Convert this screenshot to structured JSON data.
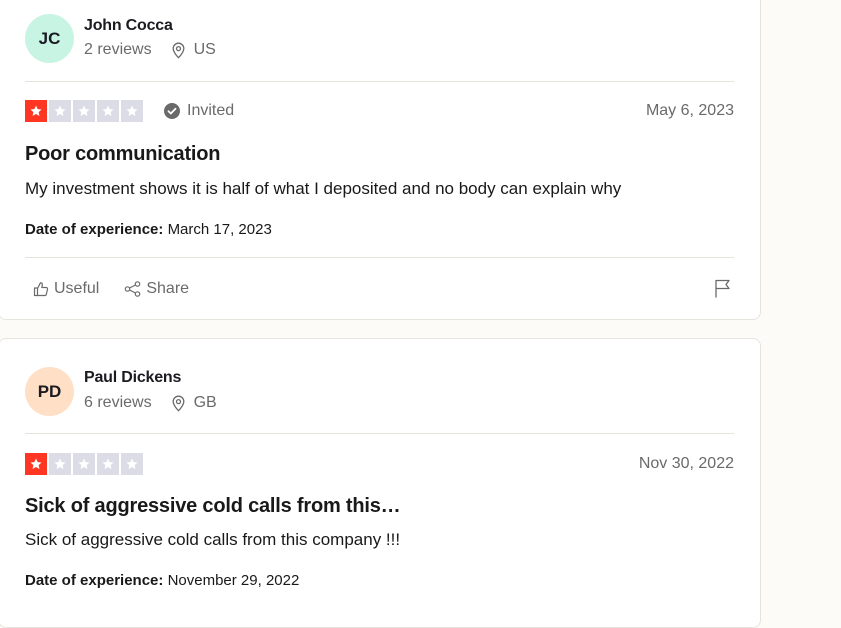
{
  "reviews": [
    {
      "initials": "JC",
      "avatar_color": "#c7f4e3",
      "name": "John Cocca",
      "reviews_count": "2 reviews",
      "country": "US",
      "rating": 1,
      "invited_label": "Invited",
      "date": "May 6, 2023",
      "title": "Poor communication",
      "body": "My investment shows it is half of what I deposited and no body can explain why",
      "experience_label": "Date of experience:",
      "experience_date": "March 17, 2023",
      "useful_label": "Useful",
      "share_label": "Share"
    },
    {
      "initials": "PD",
      "avatar_color": "#ffdfc5",
      "name": "Paul Dickens",
      "reviews_count": "6 reviews",
      "country": "GB",
      "rating": 1,
      "date": "Nov 30, 2022",
      "title": "Sick of aggressive cold calls from this…",
      "body": "Sick of aggressive cold calls from this company !!!",
      "experience_label": "Date of experience:",
      "experience_date": "November 29, 2022"
    }
  ],
  "colors": {
    "star_filled": "#ff3722",
    "star_empty": "#dcdce6",
    "text_muted": "#6a6a6a",
    "border": "#e5e5dd"
  }
}
